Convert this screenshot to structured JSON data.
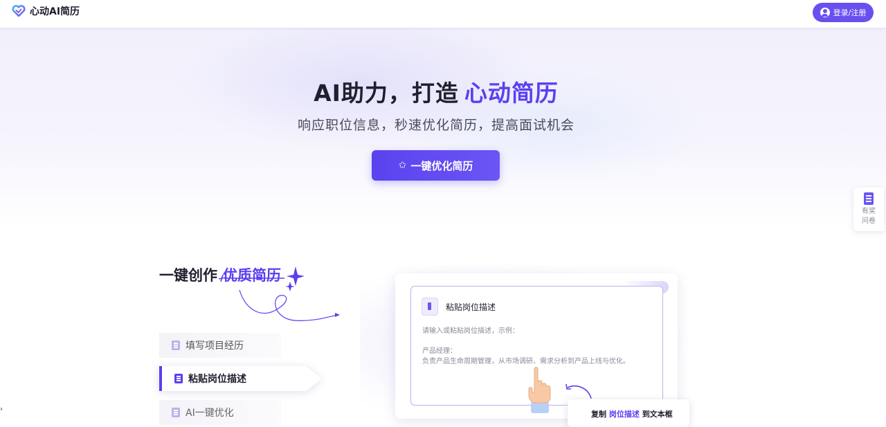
{
  "header": {
    "logo_text": "心动AI简历",
    "login_label": "登录/注册"
  },
  "hero": {
    "title_main": "AI助力，打造",
    "title_highlight": "心动简历",
    "subtitle": "响应职位信息，秒速优化简历，提高面试机会",
    "cta_label": "一键优化简历",
    "cta_icon": "sparkle-icon"
  },
  "survey_tab": {
    "label": "有奖问卷"
  },
  "features": {
    "title_main": "一键创作",
    "title_highlight": "优质简历",
    "steps": [
      {
        "label": "填写项目经历"
      },
      {
        "label": "粘贴岗位描述"
      },
      {
        "label": "AI一键优化"
      }
    ],
    "active_step": 1
  },
  "preview": {
    "panel_title": "粘贴岗位描述",
    "hint": "请输入或粘贴岗位描述，示例：",
    "example_role": "产品经理：",
    "example_desc": "负责产品生命周期管理，从市场调研、需求分析到产品上线与优化。",
    "tooltip_prefix": "复制",
    "tooltip_highlight": "岗位描述",
    "tooltip_suffix": "到文本框"
  },
  "colors": {
    "accent": "#5b3ff0",
    "button": "#6a4ff0"
  }
}
